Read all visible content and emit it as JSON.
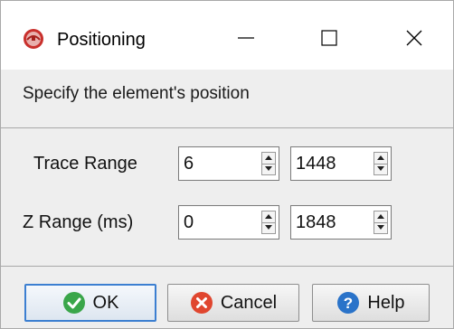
{
  "window": {
    "title": "Positioning",
    "app_icon": "app-icon",
    "controls": [
      "minimize-icon",
      "maximize-icon",
      "close-icon"
    ]
  },
  "dialog": {
    "instruction": "Specify the element's position",
    "trace_range": {
      "label": "Trace Range",
      "from": "6",
      "to": "1448"
    },
    "z_range": {
      "label": "Z Range (ms)",
      "from": "0",
      "to": "1848"
    }
  },
  "buttons": {
    "ok": {
      "label": "OK",
      "icon": "check-icon"
    },
    "cancel": {
      "label": "Cancel",
      "icon": "cancel-icon"
    },
    "help": {
      "label": "Help",
      "icon": "help-icon"
    }
  },
  "colors": {
    "focus_border": "#3c7fd1",
    "ok_green": "#3aa64a",
    "cancel_red": "#e0462f",
    "help_blue": "#2a73c9"
  }
}
